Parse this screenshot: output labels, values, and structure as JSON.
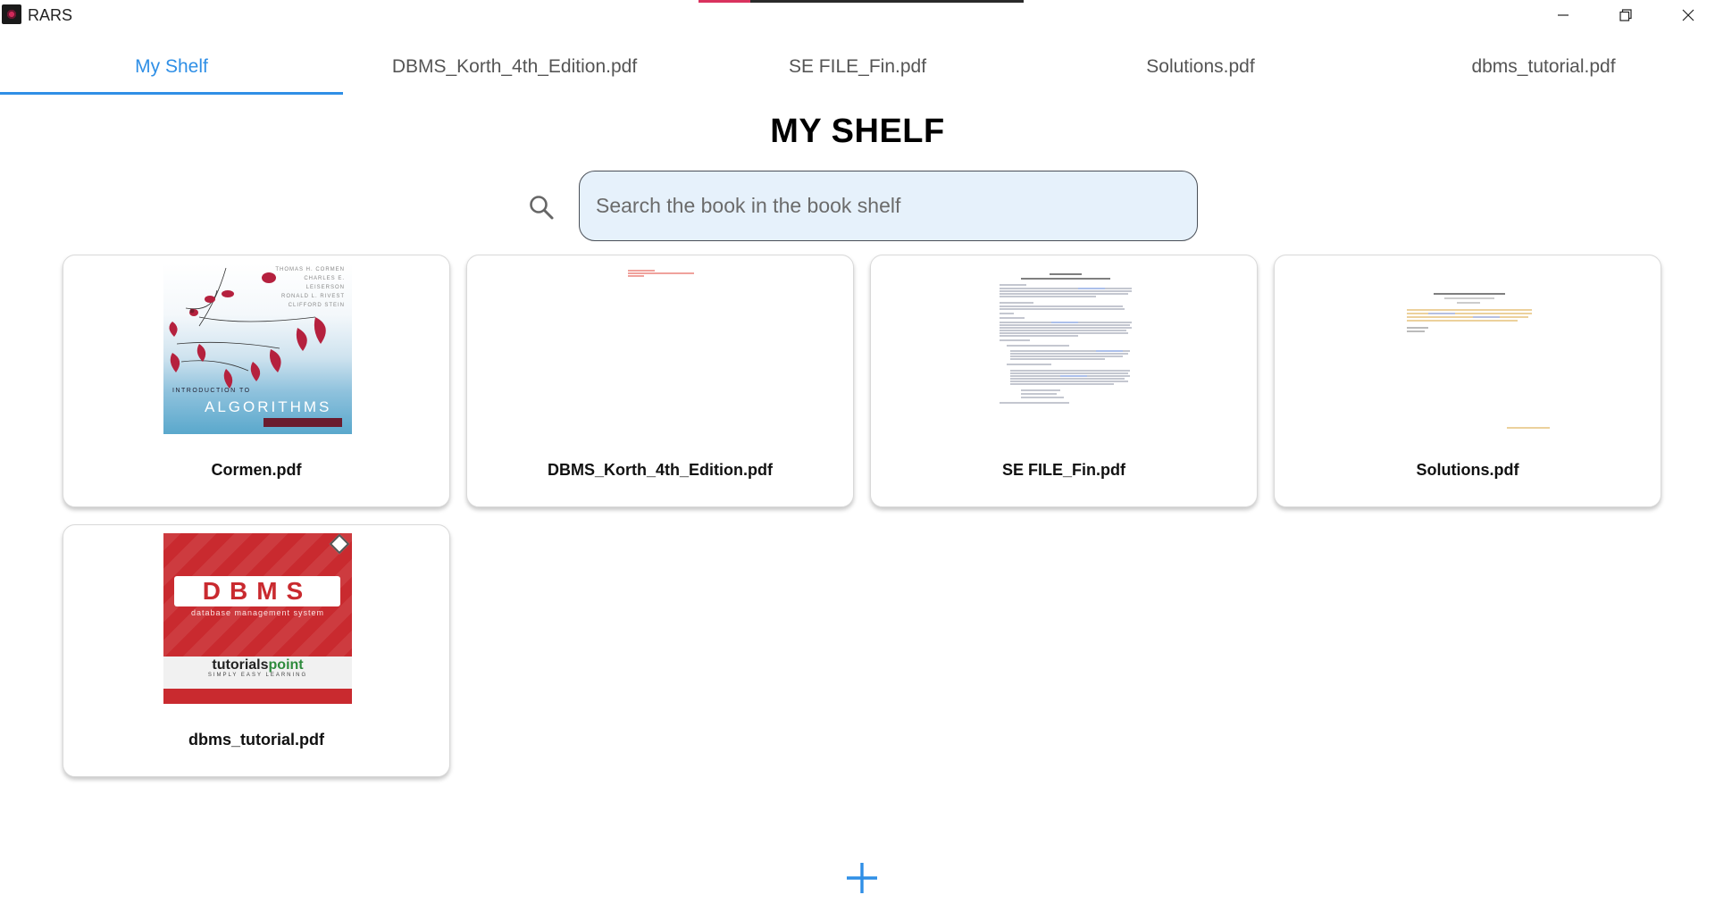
{
  "window": {
    "title": "RARS",
    "controls": {
      "minimize": "minimize",
      "maximize": "maximize",
      "close": "close"
    },
    "accent": "#d9325e",
    "progress": 0.16
  },
  "tabs": [
    {
      "label": "My Shelf",
      "active": true
    },
    {
      "label": "DBMS_Korth_4th_Edition.pdf",
      "active": false
    },
    {
      "label": "SE FILE_Fin.pdf",
      "active": false
    },
    {
      "label": "Solutions.pdf",
      "active": false
    },
    {
      "label": "dbms_tutorial.pdf",
      "active": false
    }
  ],
  "heading": "MY SHELF",
  "search": {
    "placeholder": "Search the book in the book shelf",
    "value": ""
  },
  "books": [
    {
      "name": "Cormen.pdf",
      "cover": {
        "authors": [
          "THOMAS H. CORMEN",
          "CHARLES E. LEISERSON",
          "RONALD L. RIVEST",
          "CLIFFORD STEIN"
        ],
        "line1": "INTRODUCTION TO",
        "line2": "ALGORITHMS"
      }
    },
    {
      "name": "DBMS_Korth_4th_Edition.pdf"
    },
    {
      "name": "SE FILE_Fin.pdf"
    },
    {
      "name": "Solutions.pdf"
    },
    {
      "name": "dbms_tutorial.pdf",
      "cover": {
        "title": "DBMS",
        "subtitle": "database management system",
        "brand_a": "tutorials",
        "brand_b": "point",
        "tagline": "SIMPLY EASY LEARNING"
      }
    }
  ],
  "colors": {
    "tab_active": "#2f8fe6",
    "search_bg": "#e6f1fb",
    "add_button": "#2f8fe6"
  },
  "icons": {
    "search": "search-icon",
    "add": "plus-icon"
  }
}
